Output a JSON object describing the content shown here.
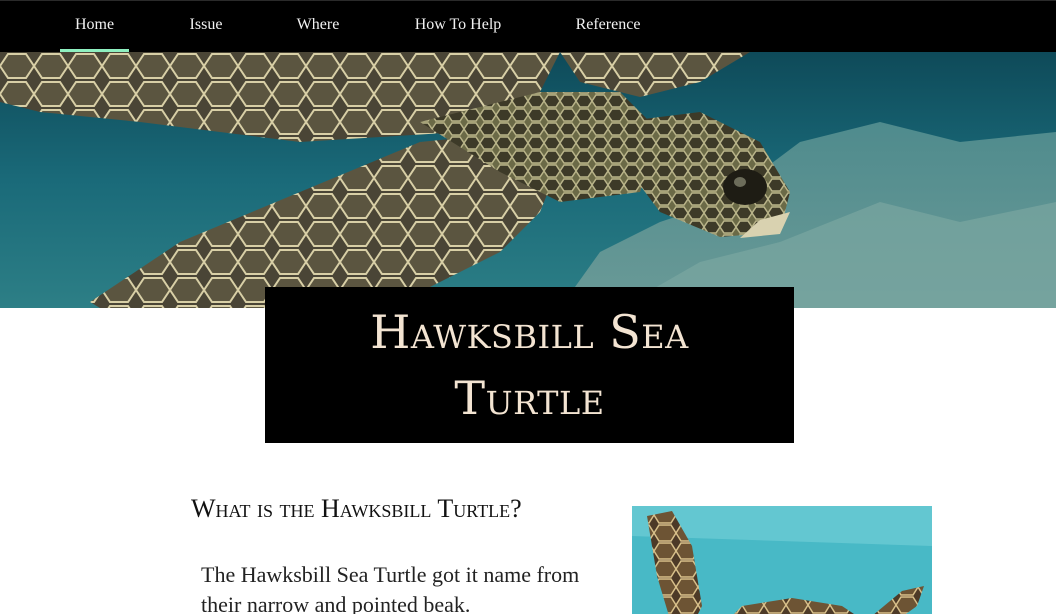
{
  "nav": {
    "items": [
      {
        "label": "Home",
        "active": true
      },
      {
        "label": "Issue",
        "active": false
      },
      {
        "label": "Where",
        "active": false
      },
      {
        "label": "How To Help",
        "active": false
      },
      {
        "label": "Reference",
        "active": false
      }
    ],
    "active_underline_color": "#8ff0c0"
  },
  "hero": {
    "image_alt": "Sea turtle swimming underwater over a reef"
  },
  "title": {
    "text": "Hawksbill Sea Turtle"
  },
  "section": {
    "heading": "What is the Hawksbill Turtle?",
    "paragraph": "The Hawksbill Sea Turtle got it name from their narrow and pointed beak."
  },
  "side_photo": {
    "image_alt": "Hawksbill turtle swimming in shallow turquoise water"
  }
}
